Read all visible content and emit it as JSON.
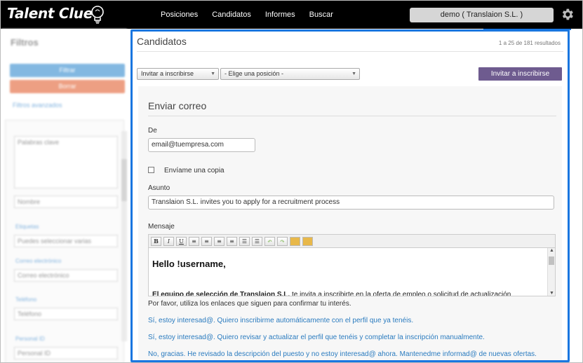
{
  "header": {
    "logo_text": "Talent Clue",
    "nav": [
      "Posiciones",
      "Candidatos",
      "Informes",
      "Buscar"
    ],
    "account": "demo ( Translaion S.L. )",
    "gear_icon": "gear-icon",
    "bulb_icon": "lightbulb-icon"
  },
  "sidebar": {
    "title": "Filtros",
    "filter_button": "Filtrar",
    "clear_button": "Borrar",
    "advanced_link": "Filtros avanzados",
    "keywords_placeholder": "Palabras clave",
    "name_select": "Nombre",
    "label_1": "Etiquetas",
    "field_1": "Puedes seleccionar varias",
    "label_2": "Correo electrónico",
    "field_2": "Correo electrónico",
    "label_3": "Teléfono",
    "field_3": "Teléfono",
    "label_4": "Personal ID",
    "field_4": "Personal ID",
    "colors": {
      "filter": "#5aa1d8",
      "clear": "#e8805a"
    }
  },
  "main": {
    "title": "Candidatos",
    "count": "1 a 25 de 181 resultados",
    "select_action": "Invitar a inscribirse",
    "select_position": "- Elige una posición -",
    "invite_button": "Invitar a inscribirse",
    "form": {
      "title": "Enviar correo",
      "from_label": "De",
      "from_value": "email@tuempresa.com",
      "copy_label": "Envíame una copia",
      "subject_label": "Asunto",
      "subject_value": "Translaion S.L. invites you to apply for a recruitment process",
      "message_label": "Mensaje",
      "toolbar": [
        "B",
        "I",
        "U",
        "≡",
        "≡",
        "≡",
        "≡",
        "☰",
        "☰",
        "↶",
        "↷",
        "📋",
        "📋"
      ],
      "editor_heading": "Hello !username,",
      "editor_para_bold": "El equipo de selección de Translaion S.L.",
      "editor_para_rest": " te invita a inscribirte en la oferta de empleo o solicitud de actualización",
      "confirm_text": "Por favor, utiliza los enlaces que siguen para confirmar tu interés.",
      "link_1": "Sí, estoy interesad@. Quiero inscribirme automáticamente con el perfil que ya tenéis.",
      "link_2": "Sí, estoy interesad@. Quiero revisar y actualizar el perfil que tenéis y completar la inscripción manualmente.",
      "link_3": "No, gracias. He revisado la descripción del puesto y no estoy interesad@ ahora. Mantenedme informad@ de nuevas ofertas."
    },
    "accent": "#1976e0",
    "button_color": "#6e5b8f"
  }
}
